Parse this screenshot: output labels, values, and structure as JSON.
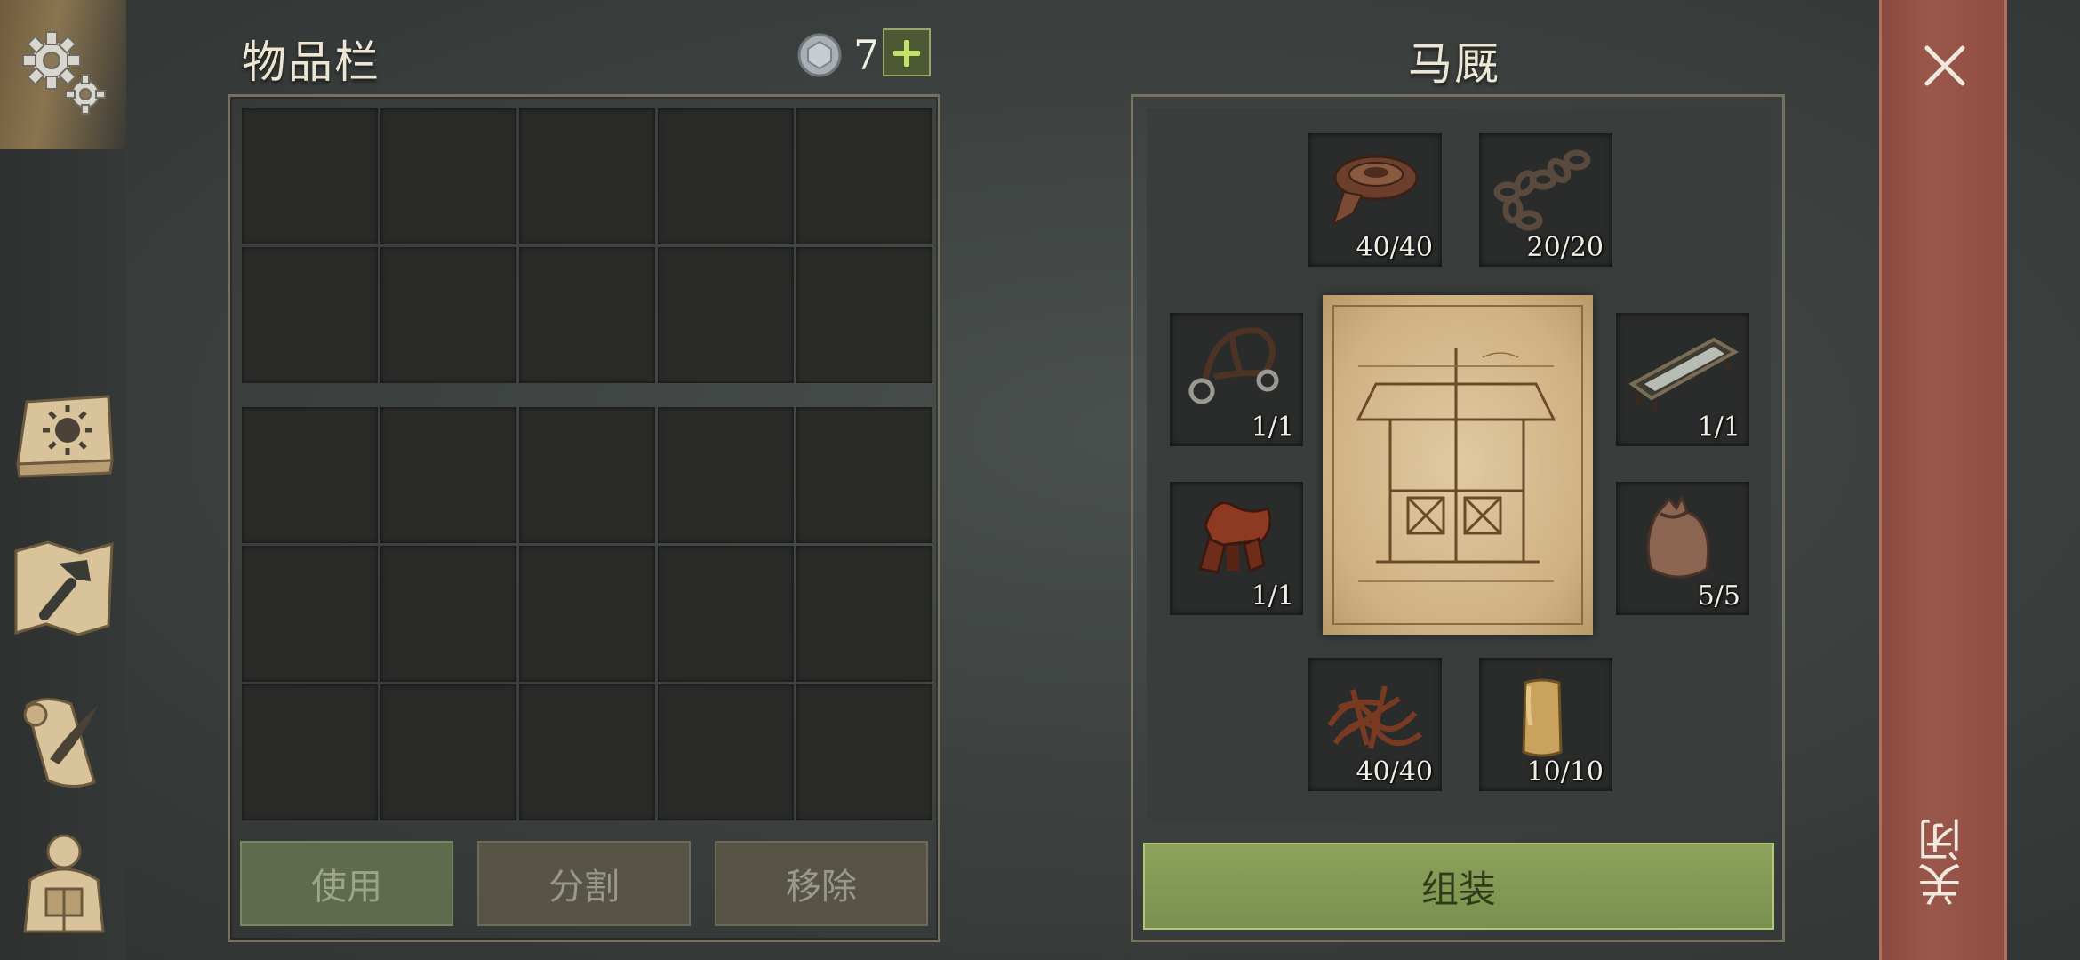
{
  "inventory": {
    "title": "物品栏",
    "coin_count": "7",
    "buttons": {
      "use": "使用",
      "split": "分割",
      "remove": "移除"
    }
  },
  "stable": {
    "title": "马厩",
    "slots": [
      {
        "icon": "leather-roll-icon",
        "count": "40/40"
      },
      {
        "icon": "chain-icon",
        "count": "20/20"
      },
      {
        "icon": "bridle-icon",
        "count": "1/1"
      },
      {
        "icon": "trough-icon",
        "count": "1/1"
      },
      {
        "icon": "saddle-icon",
        "count": "1/1"
      },
      {
        "icon": "sack-icon",
        "count": "5/5"
      },
      {
        "icon": "rope-pile-icon",
        "count": "40/40"
      },
      {
        "icon": "candle-icon",
        "count": "10/10"
      }
    ],
    "assemble_label": "组装"
  },
  "close": {
    "label": "关闭"
  },
  "colors": {
    "accent_green": "#8da25a",
    "close_panel": "#9a574b",
    "parchment": "#d9c095"
  }
}
